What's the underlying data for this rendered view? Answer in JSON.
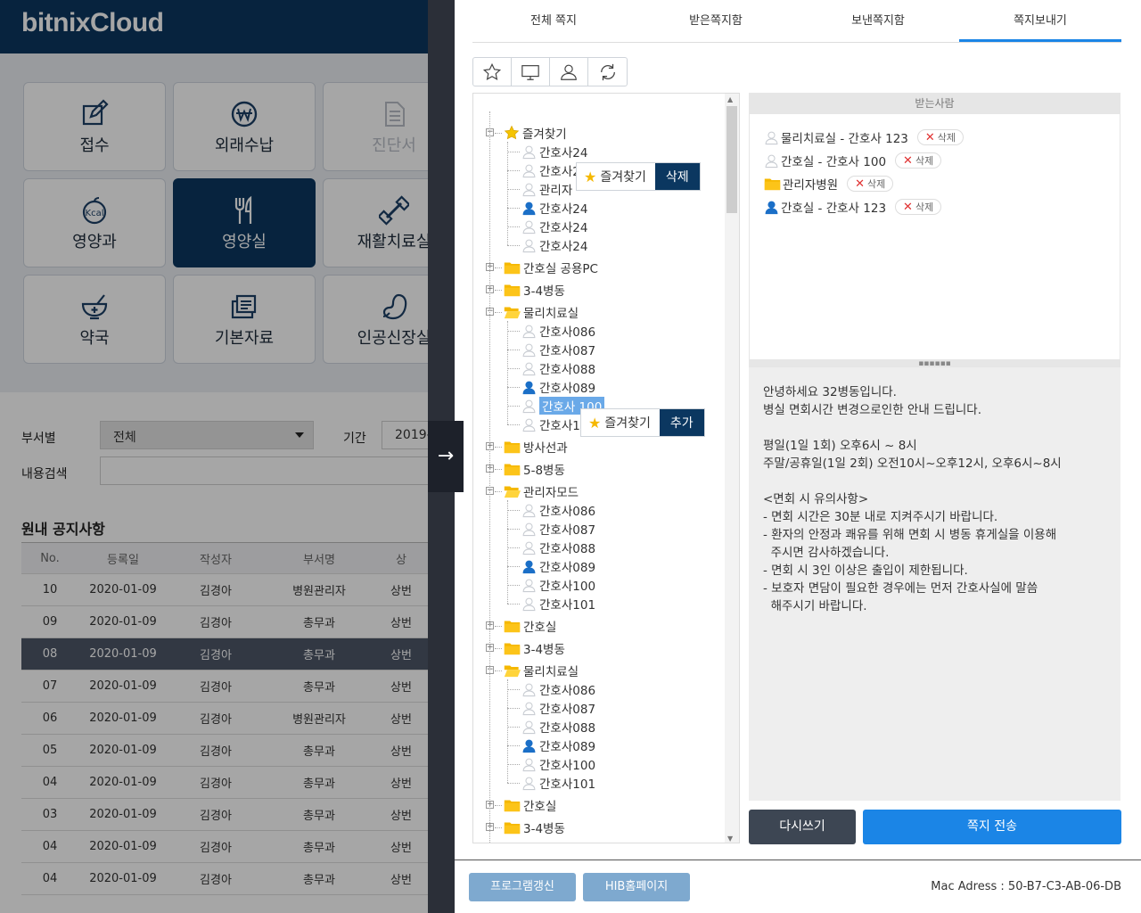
{
  "app": {
    "logo": "bitnixCloud"
  },
  "tiles": [
    {
      "label": "접수",
      "icon": "edit-icon",
      "state": "normal"
    },
    {
      "label": "외래수납",
      "icon": "won-icon",
      "state": "normal"
    },
    {
      "label": "진단서",
      "icon": "document-icon",
      "state": "disabled"
    },
    {
      "label": "영양과",
      "icon": "kcal-icon",
      "state": "normal"
    },
    {
      "label": "영양실",
      "icon": "fork-knife-icon",
      "state": "active"
    },
    {
      "label": "재활치료실",
      "icon": "dumbbell-icon",
      "state": "normal"
    },
    {
      "label": "약국",
      "icon": "mortar-icon",
      "state": "normal"
    },
    {
      "label": "기본자료",
      "icon": "folder-icon",
      "state": "normal"
    },
    {
      "label": "인공신장실",
      "icon": "kidney-icon",
      "state": "normal"
    }
  ],
  "filters": {
    "dept_label": "부서별",
    "dept_value": "전체",
    "period_label": "기간",
    "period_value": "2019-1",
    "search_label": "내용검색"
  },
  "notice": {
    "title": "원내 공지사항",
    "columns": [
      "No.",
      "등록일",
      "작성자",
      "부서명",
      "상"
    ],
    "rows": [
      [
        "10",
        "2020-01-09",
        "김경아",
        "병원관리자",
        "상번"
      ],
      [
        "09",
        "2020-01-09",
        "김경아",
        "총무과",
        "상번"
      ],
      [
        "08",
        "2020-01-09",
        "김경아",
        "총무과",
        "상번"
      ],
      [
        "07",
        "2020-01-09",
        "김경아",
        "총무과",
        "상번"
      ],
      [
        "06",
        "2020-01-09",
        "김경아",
        "병원관리자",
        "상번"
      ],
      [
        "05",
        "2020-01-09",
        "김경아",
        "총무과",
        "상번"
      ],
      [
        "04",
        "2020-01-09",
        "김경아",
        "총무과",
        "상번"
      ],
      [
        "03",
        "2020-01-09",
        "김경아",
        "총무과",
        "상번"
      ],
      [
        "04",
        "2020-01-09",
        "김경아",
        "총무과",
        "상번"
      ],
      [
        "04",
        "2020-01-09",
        "김경아",
        "총무과",
        "상번"
      ]
    ],
    "selected_row": 2
  },
  "panel": {
    "tabs": [
      "전체 쪽지",
      "받은쪽지함",
      "보낸쪽지함",
      "쪽지보내기"
    ],
    "active_tab": 3,
    "toolbar_icons": [
      "star-icon",
      "monitor-icon",
      "user-icon",
      "refresh-icon"
    ],
    "tree": [
      {
        "label": "즐겨찾기",
        "kind": "star",
        "level": 0,
        "expanded": true
      },
      {
        "label": "간호사24",
        "kind": "user",
        "level": 1
      },
      {
        "label": "간호사24",
        "kind": "user",
        "level": 1
      },
      {
        "label": "관리자",
        "kind": "user",
        "level": 1
      },
      {
        "label": "간호사24",
        "kind": "user-active",
        "level": 1
      },
      {
        "label": "간호사24",
        "kind": "user",
        "level": 1
      },
      {
        "label": "간호사24",
        "kind": "user",
        "level": 1
      },
      {
        "label": "간호실 공용PC",
        "kind": "folder",
        "level": 0
      },
      {
        "label": "3-4병동",
        "kind": "folder",
        "level": 0
      },
      {
        "label": "물리치료실",
        "kind": "folder-open",
        "level": 0,
        "expanded": true
      },
      {
        "label": "간호사086",
        "kind": "user",
        "level": 1
      },
      {
        "label": "간호사087",
        "kind": "user",
        "level": 1
      },
      {
        "label": "간호사088",
        "kind": "user",
        "level": 1
      },
      {
        "label": "간호사089",
        "kind": "user-active",
        "level": 1
      },
      {
        "label": "간호사 100",
        "kind": "user",
        "level": 1,
        "highlight": true
      },
      {
        "label": "간호사101",
        "kind": "user",
        "level": 1
      },
      {
        "label": "방사선과",
        "kind": "folder",
        "level": 0
      },
      {
        "label": "5-8병동",
        "kind": "folder",
        "level": 0
      },
      {
        "label": "관리자모드",
        "kind": "folder-open",
        "level": 0,
        "expanded": true
      },
      {
        "label": "간호사086",
        "kind": "user",
        "level": 1
      },
      {
        "label": "간호사087",
        "kind": "user",
        "level": 1
      },
      {
        "label": "간호사088",
        "kind": "user",
        "level": 1
      },
      {
        "label": "간호사089",
        "kind": "user-active",
        "level": 1
      },
      {
        "label": "간호사100",
        "kind": "user",
        "level": 1
      },
      {
        "label": "간호사101",
        "kind": "user",
        "level": 1
      },
      {
        "label": "간호실",
        "kind": "folder",
        "level": 0
      },
      {
        "label": "3-4병동",
        "kind": "folder",
        "level": 0
      },
      {
        "label": "물리치료실",
        "kind": "folder-open",
        "level": 0,
        "expanded": true
      },
      {
        "label": "간호사086",
        "kind": "user",
        "level": 1
      },
      {
        "label": "간호사087",
        "kind": "user",
        "level": 1
      },
      {
        "label": "간호사088",
        "kind": "user",
        "level": 1
      },
      {
        "label": "간호사089",
        "kind": "user-active",
        "level": 1
      },
      {
        "label": "간호사100",
        "kind": "user",
        "level": 1
      },
      {
        "label": "간호사101",
        "kind": "user",
        "level": 1
      },
      {
        "label": "간호실",
        "kind": "folder",
        "level": 0
      },
      {
        "label": "3-4병동",
        "kind": "folder",
        "level": 0
      },
      {
        "label": "물리치료실",
        "kind": "folder-open",
        "level": 0
      }
    ],
    "popup_delete": {
      "label": "즐겨찾기",
      "action": "삭제"
    },
    "popup_add": {
      "label": "즐겨찾기",
      "action": "추가"
    },
    "recipients_header": "받는사람",
    "recipients": [
      {
        "label": "물리치료실 - 간호사 123",
        "kind": "user"
      },
      {
        "label": "간호실 - 간호사 100",
        "kind": "user"
      },
      {
        "label": "관리자병원",
        "kind": "folder"
      },
      {
        "label": "간호실 - 간호사 123",
        "kind": "user-active"
      }
    ],
    "delete_label": "삭제",
    "message": "안녕하세요 32병동입니다.\n병실 면회시간 변경으로인한 안내 드립니다.\n\n평일(1일 1회) 오후6시 ~ 8시\n주말/공휴일(1일 2회) 오전10시~오후12시, 오후6시~8시\n\n<면회 시 유의사항>\n- 면회 시간은 30분 내로 지켜주시기 바랍니다.\n- 환자의 안정과 쾌유를 위해 면회 시 병동 휴게실을 이용해\n  주시면 감사하겠습니다.\n- 면회 시 3인 이상은 출입이 제한됩니다.\n- 보호자 면담이 필요한 경우에는 먼저 간호사실에 말씀\n  해주시기 바랍니다.",
    "rewrite_label": "다시쓰기",
    "send_label": "쪽지 전송"
  },
  "footer": {
    "update_label": "프로그램갱신",
    "homepage_label": "HIB홈페이지",
    "mac_label": "Mac Adress",
    "mac_sep": ":",
    "mac_value": "50-B7-C3-AB-06-DB"
  },
  "colors": {
    "brand": "#0b3760",
    "accent": "#1b85e6",
    "user_active": "#1b6fc7",
    "folder": "#f5b800"
  }
}
